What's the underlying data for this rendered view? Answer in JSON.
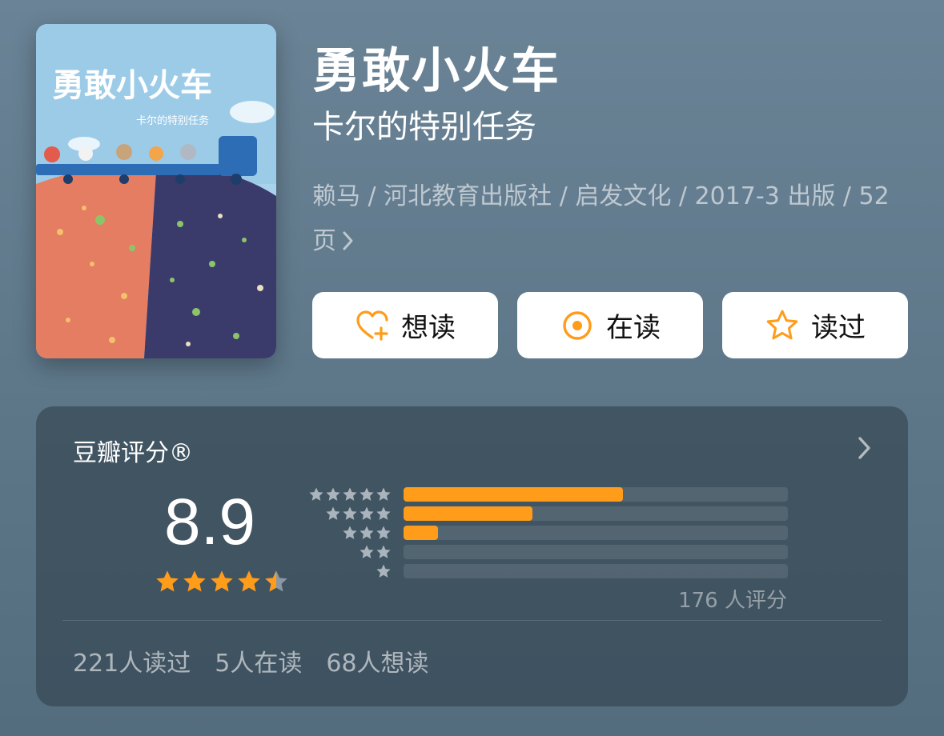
{
  "book": {
    "title": "勇敢小火车",
    "subtitle": "卡尔的特别任务",
    "meta": "赖马 / 河北教育出版社 / 启发文化 / 2017-3 出版 / 52页",
    "cover": {
      "title_text": "勇敢小火车",
      "subtitle_text": "卡尔的特别任务"
    }
  },
  "actions": {
    "want_label": "想读",
    "reading_label": "在读",
    "read_label": "读过"
  },
  "rating": {
    "panel_title": "豆瓣评分®",
    "score": "8.9",
    "score_stars_value": 4.5,
    "distribution": [
      {
        "stars": 5,
        "fraction": 0.57
      },
      {
        "stars": 4,
        "fraction": 0.335
      },
      {
        "stars": 3,
        "fraction": 0.09
      },
      {
        "stars": 2,
        "fraction": 0.0
      },
      {
        "stars": 1,
        "fraction": 0.0
      }
    ],
    "count_text": "176 人评分",
    "stats": {
      "read": "221人读过",
      "reading": "5人在读",
      "want": "68人想读"
    }
  },
  "colors": {
    "accent": "#ff9c1a",
    "background": "#5f788a",
    "panel": "#3b4d5a"
  },
  "icons": [
    "heart-plus-icon",
    "target-icon",
    "star-outline-icon",
    "chevron-right-icon",
    "star-icon"
  ]
}
